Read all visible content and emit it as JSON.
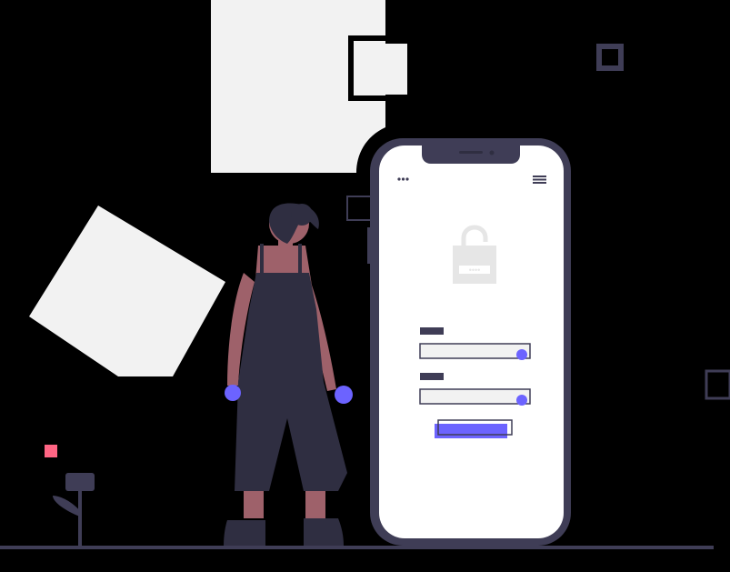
{
  "illustration": {
    "colors": {
      "background": "#000000",
      "shape_light": "#f2f2f2",
      "phone_frame": "#3f3d56",
      "screen": "#ffffff",
      "accent": "#6c63ff",
      "skin": "#9e616a",
      "hair": "#2f2e41",
      "pink_dot": "#ff6584",
      "ground": "#3f3d56"
    },
    "phone_screen": {
      "menu_dots_icon": "more-dots-icon",
      "hamburger_icon": "hamburger-menu-icon",
      "lock_icon": "unlocked-padlock-icon",
      "password_dots": "••••",
      "fields": [
        {
          "name": "username-field",
          "has_focus_dot": true
        },
        {
          "name": "password-field",
          "has_focus_dot": true
        }
      ],
      "submit_button": "login-submit-button"
    },
    "figure": "woman-in-overalls",
    "plant": "decorative-plant"
  }
}
